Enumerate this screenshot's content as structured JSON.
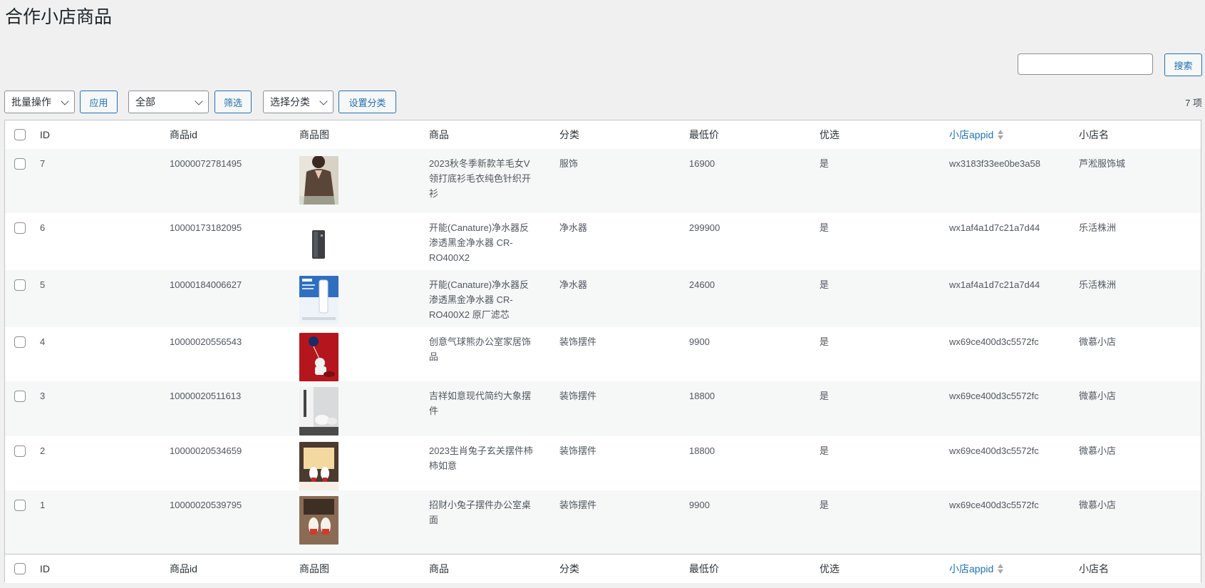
{
  "page": {
    "title": "合作小店商品"
  },
  "search": {
    "value": "",
    "button_label": "搜索"
  },
  "toolbar": {
    "bulk_select": "批量操作",
    "apply_label": "应用",
    "filter_select": "全部",
    "filter_label": "筛选",
    "category_select": "选择分类",
    "set_category_label": "设置分类",
    "item_count": "7 项"
  },
  "table": {
    "columns": {
      "id": "ID",
      "product_id": "商品id",
      "image": "商品图",
      "product": "商品",
      "category": "分类",
      "min_price": "最低价",
      "preferred": "优选",
      "shop_appid": "小店appid",
      "shop_name": "小店名"
    },
    "rows": [
      {
        "id": "7",
        "product_id": "10000072781495",
        "product_lines": [
          "2023秋冬季新款羊毛女V",
          "领打底衫毛衣纯色针织开",
          "衫"
        ],
        "category": "服饰",
        "min_price": "16900",
        "preferred": "是",
        "shop_appid": "wx3183f33ee0be3a58",
        "shop_name": "芦淞服饰城",
        "image": "sweater-photo"
      },
      {
        "id": "6",
        "product_id": "10000173182095",
        "product_lines": [
          "开能(Canature)净水器反",
          "渗透黑金净水器 CR-",
          "RO400X2"
        ],
        "category": "净水器",
        "min_price": "299900",
        "preferred": "是",
        "shop_appid": "wx1af4a1d7c21a7d44",
        "shop_name": "乐活株洲",
        "image": "water-purifier-photo"
      },
      {
        "id": "5",
        "product_id": "10000184006627",
        "product_lines": [
          "开能(Canature)净水器反",
          "渗透黑金净水器 CR-",
          "RO400X2 原厂滤芯"
        ],
        "category": "净水器",
        "min_price": "24600",
        "preferred": "是",
        "shop_appid": "wx1af4a1d7c21a7d44",
        "shop_name": "乐活株洲",
        "image": "filter-photo"
      },
      {
        "id": "4",
        "product_id": "10000020556543",
        "product_lines": [
          "创意气球熊办公室家居饰",
          "品"
        ],
        "category": "装饰摆件",
        "min_price": "9900",
        "preferred": "是",
        "shop_appid": "wx69ce400d3c5572fc",
        "shop_name": "微慕小店",
        "image": "balloon-bear-photo"
      },
      {
        "id": "3",
        "product_id": "10000020511613",
        "product_lines": [
          "吉祥如意现代简约大象摆",
          "件"
        ],
        "category": "装饰摆件",
        "min_price": "18800",
        "preferred": "是",
        "shop_appid": "wx69ce400d3c5572fc",
        "shop_name": "微慕小店",
        "image": "elephant-photo"
      },
      {
        "id": "2",
        "product_id": "10000020534659",
        "product_lines": [
          "2023生肖兔子玄关摆件柿",
          "柿如意"
        ],
        "category": "装饰摆件",
        "min_price": "18800",
        "preferred": "是",
        "shop_appid": "wx69ce400d3c5572fc",
        "shop_name": "微慕小店",
        "image": "rabbit-photo"
      },
      {
        "id": "1",
        "product_id": "10000020539795",
        "product_lines": [
          "招财小兔子摆件办公室桌",
          "面"
        ],
        "category": "装饰摆件",
        "min_price": "9900",
        "preferred": "是",
        "shop_appid": "wx69ce400d3c5572fc",
        "shop_name": "微慕小店",
        "image": "rabbits-photo"
      }
    ]
  }
}
